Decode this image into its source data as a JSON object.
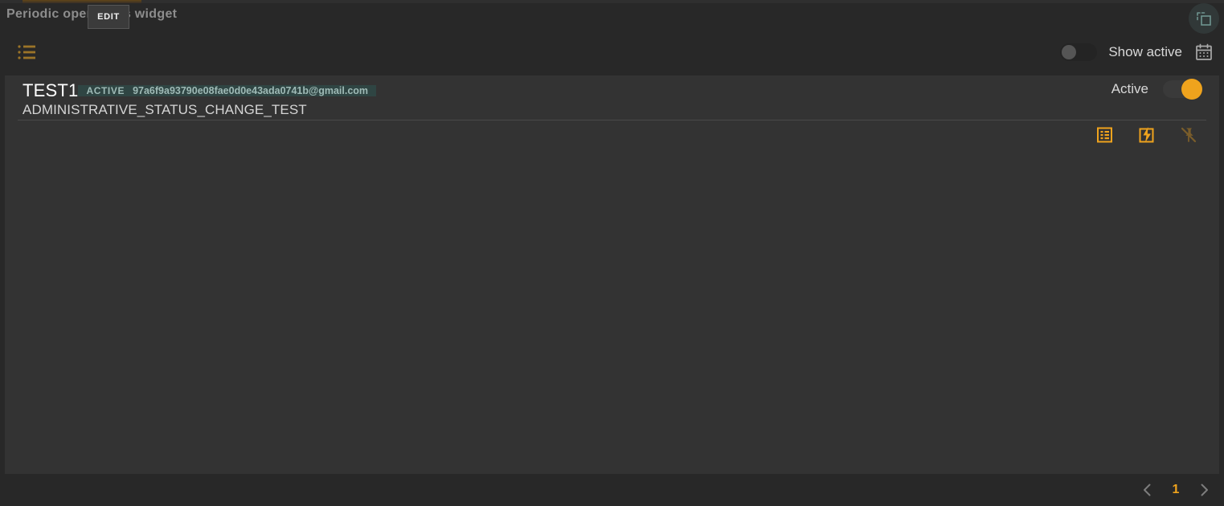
{
  "widget": {
    "title": "Periodic operations widget",
    "edit_tooltip": "EDIT",
    "resize_icon": "widget-resize-icon"
  },
  "toolbar": {
    "list_icon": "list-view-icon",
    "show_active_label": "Show active",
    "show_active_toggle_state": "off",
    "calendar_icon": "calendar-icon"
  },
  "rows": [
    {
      "name": "TEST1",
      "status_badge": "ACTIVE",
      "email": "97a6f9a93790e08fae0d0e43ada0741b@gmail.com",
      "operation": "ADMINISTRATIVE_STATUS_CHANGE_TEST",
      "active_label": "Active",
      "active_toggle_state": "on",
      "actions": [
        {
          "icon": "details-list-icon",
          "enabled": true
        },
        {
          "icon": "execute-bolt-icon",
          "enabled": true
        },
        {
          "icon": "pin-off-icon",
          "enabled": false
        }
      ]
    }
  ],
  "pagination": {
    "prev_label": "prev-page",
    "current_page": "1",
    "next_label": "next-page"
  },
  "colors": {
    "page_background": "#282828",
    "card_background": "#333333",
    "accent_orange": "#efa31d",
    "accent_teal": "#6f9490",
    "selection_highlight": "#2f4543",
    "text_primary": "#ffffff",
    "text_secondary": "#d5d5d5",
    "text_muted": "#8d8d8d"
  }
}
